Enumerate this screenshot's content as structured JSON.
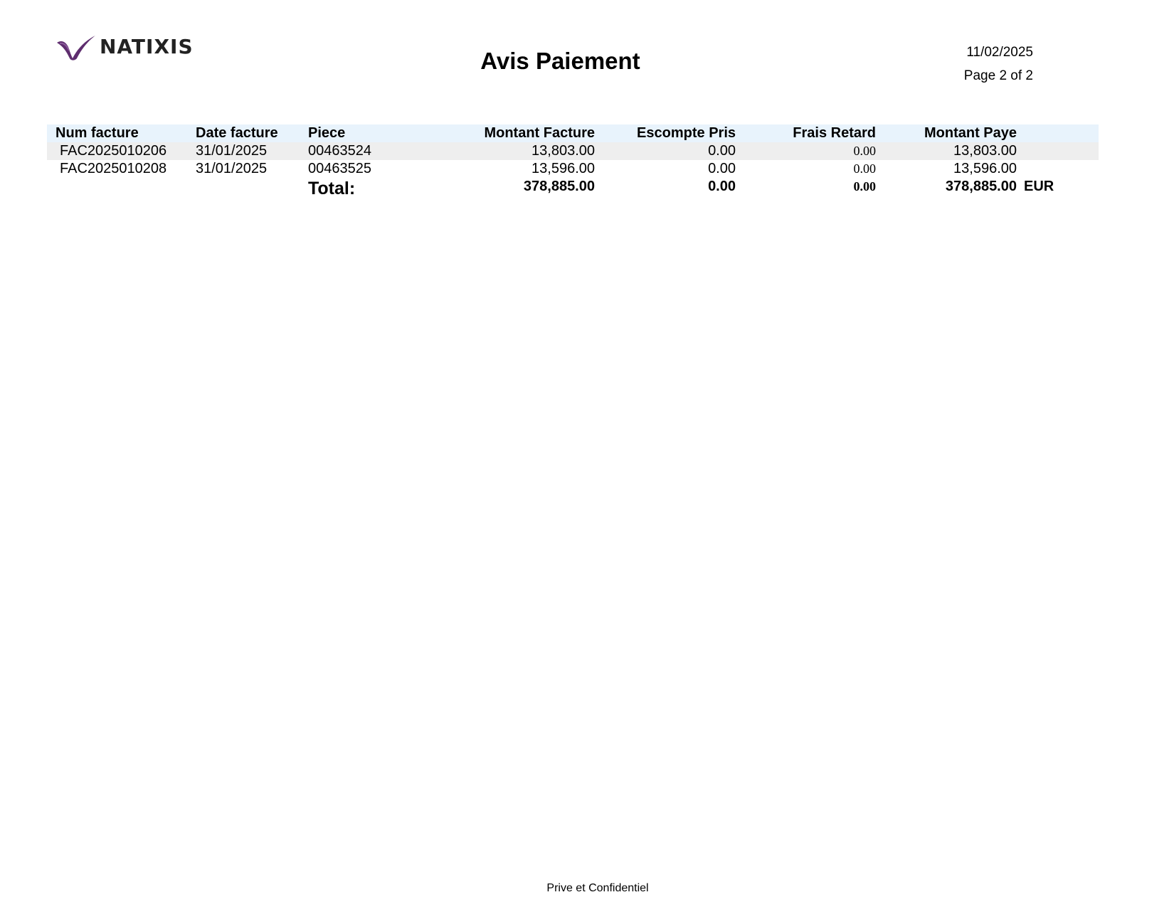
{
  "brand": {
    "logo_text": "NATIXIS",
    "logo_color": "#5e2d6e"
  },
  "header": {
    "title": "Avis Paiement",
    "date": "11/02/2025",
    "page": "Page 2 of 2"
  },
  "table": {
    "columns": [
      "Num facture",
      "Date facture",
      "Piece",
      "Montant Facture",
      "Escompte Pris",
      "Frais Retard",
      "Montant Paye"
    ],
    "rows": [
      [
        "FAC2025010206",
        "31/01/2025",
        "00463524",
        "13,803.00",
        "0.00",
        "0.00",
        "13,803.00"
      ],
      [
        "FAC2025010208",
        "31/01/2025",
        "00463525",
        "13,596.00",
        "0.00",
        "0.00",
        "13,596.00"
      ]
    ],
    "total": {
      "label": "Total:",
      "montant_facture": "378,885.00",
      "escompte_pris": "0.00",
      "frais_retard": "0.00",
      "montant_paye": "378,885.00",
      "currency": "EUR"
    },
    "header_bg": "#e8f3fc",
    "shaded_row_bg": "#eeeeee"
  },
  "footer": {
    "text": "Prive et Confidentiel"
  }
}
